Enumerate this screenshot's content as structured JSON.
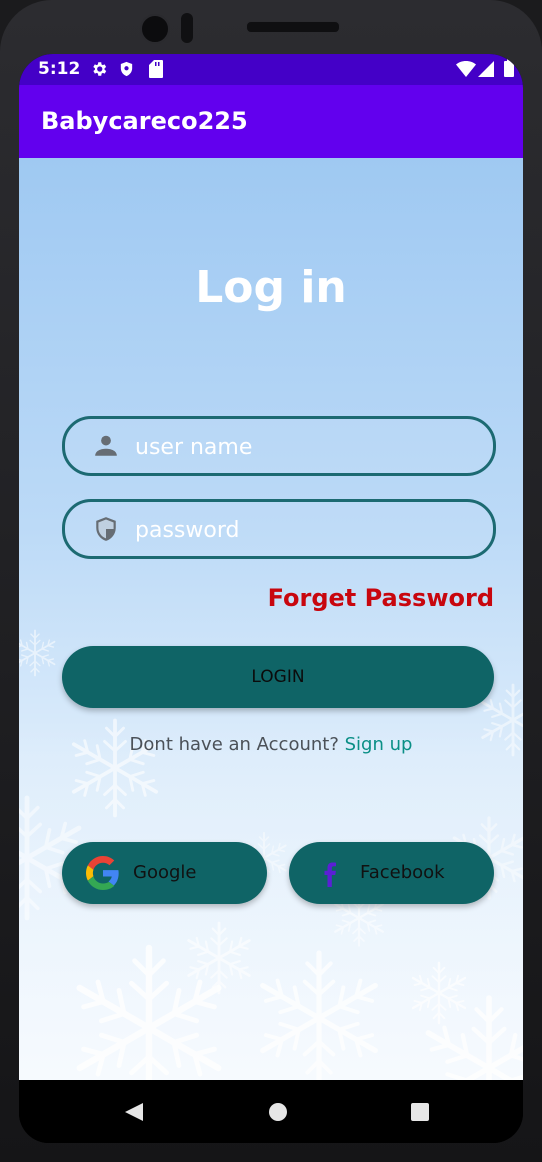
{
  "status_bar": {
    "time": "5:12",
    "icons": [
      "gear-icon",
      "shield-icon",
      "sd-card-icon",
      "wifi-icon",
      "signal-icon",
      "battery-icon"
    ]
  },
  "app_bar": {
    "title": "Babycareco225"
  },
  "login": {
    "heading": "Log in",
    "username": {
      "placeholder": "user name",
      "value": "",
      "icon": "person-icon"
    },
    "password": {
      "placeholder": "password",
      "value": "",
      "icon": "shield-icon"
    },
    "forgot_label": "Forget Password",
    "login_label": "LOGIN",
    "signup_prompt": "Dont have an Account?",
    "signup_link": "Sign up",
    "google_label": "Google",
    "facebook_label": "Facebook"
  },
  "nav_bar": {
    "icons": [
      "back-icon",
      "home-icon",
      "recents-icon"
    ]
  },
  "colors": {
    "status_bar": "#4400c7",
    "app_bar": "#6200ee",
    "accent_teal": "#0f6466",
    "field_border": "#1c6a72",
    "forgot": "#c8060e",
    "signup_link": "#0a8f86"
  }
}
